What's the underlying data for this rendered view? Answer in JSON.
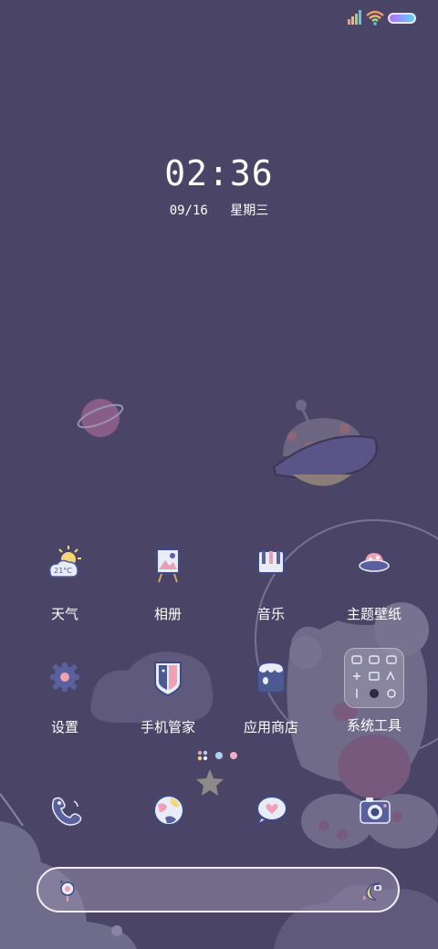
{
  "clock": {
    "time": "02:36",
    "date": "09/16",
    "weekday": "星期三"
  },
  "status_bar": {
    "icons": [
      "signal-icon",
      "wifi-icon",
      "battery-icon"
    ],
    "battery_color": "#7b6cff"
  },
  "apps": [
    {
      "label": "天气",
      "icon": "weather-icon",
      "temp": "21°C"
    },
    {
      "label": "相册",
      "icon": "gallery-icon"
    },
    {
      "label": "音乐",
      "icon": "music-icon"
    },
    {
      "label": "主题壁纸",
      "icon": "theme-wallpaper-icon"
    },
    {
      "label": "设置",
      "icon": "settings-icon"
    },
    {
      "label": "手机管家",
      "icon": "phone-manager-icon"
    },
    {
      "label": "应用商店",
      "icon": "app-store-icon"
    },
    {
      "label": "系统工具",
      "icon": "system-tools-folder-icon"
    }
  ],
  "dock": [
    {
      "icon": "phone-icon"
    },
    {
      "icon": "browser-icon"
    },
    {
      "icon": "messages-icon"
    },
    {
      "icon": "camera-icon"
    }
  ],
  "search_bar": {
    "left_icon": "search-icon",
    "right_icon": "voice-moon-icon"
  },
  "colors": {
    "background": "#4a4566",
    "icon_blue": "#5a5f9e",
    "icon_pink": "#e6a0b4",
    "text": "#ffffff"
  }
}
